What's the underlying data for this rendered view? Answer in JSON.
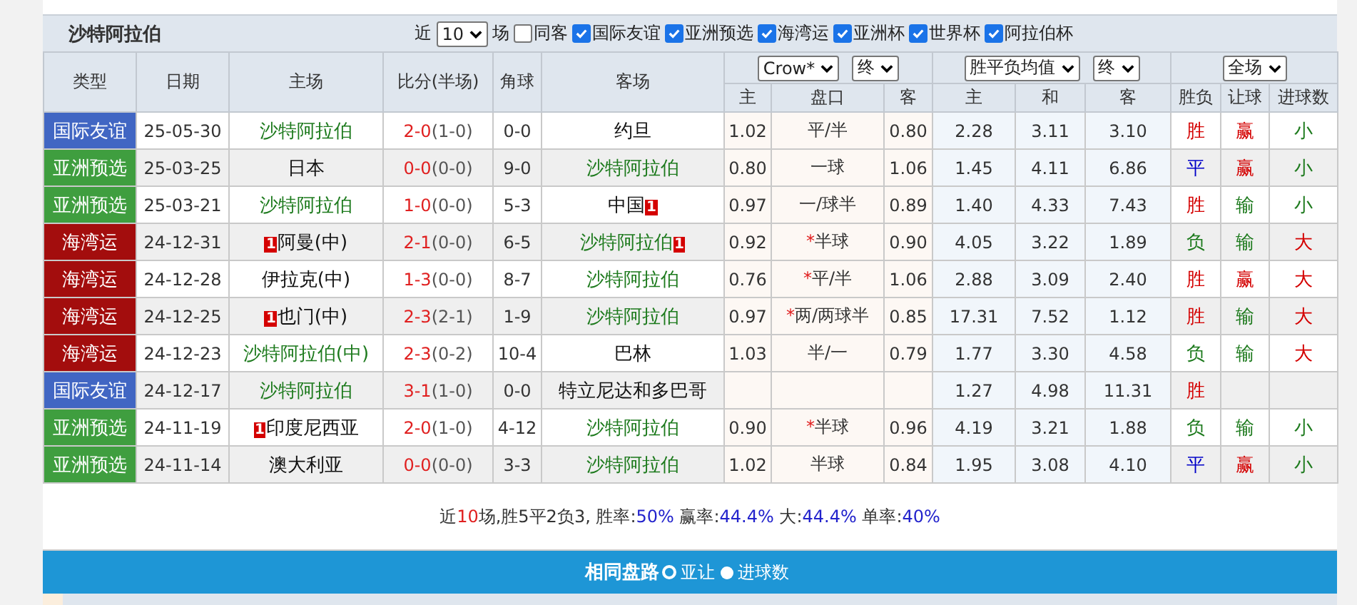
{
  "filter_bar": {
    "team": "沙特阿拉伯",
    "recent_prefix": "近",
    "recent_count": "10",
    "recent_suffix": "场",
    "checkboxes": [
      {
        "label": "同客",
        "checked": false
      },
      {
        "label": "国际友谊",
        "checked": true
      },
      {
        "label": "亚洲预选",
        "checked": true
      },
      {
        "label": "海湾运",
        "checked": true
      },
      {
        "label": "亚洲杯",
        "checked": true
      },
      {
        "label": "世界杯",
        "checked": true
      },
      {
        "label": "阿拉伯杯",
        "checked": true
      }
    ]
  },
  "columns": [
    "类型",
    "日期",
    "主场",
    "比分(半场)",
    "角球",
    "客场"
  ],
  "selects": {
    "handicap_company": "Crow*",
    "handicap_time": "终",
    "euro_company": "胜平负均值",
    "euro_time": "终",
    "period": "全场"
  },
  "subcolumns": [
    "主",
    "盘口",
    "客",
    "主",
    "和",
    "客",
    "胜负",
    "让球",
    "进球数"
  ],
  "rows": [
    {
      "type": {
        "label": "国际友谊",
        "color": "#4166c3"
      },
      "date": "25-05-30",
      "home": {
        "name": "沙特阿拉伯",
        "highlight": true
      },
      "score": {
        "full": "2-0",
        "half": "(1-0)"
      },
      "corners": "0-0",
      "away": {
        "name": "约旦",
        "highlight": false
      },
      "handicap": {
        "home": "1.02",
        "line": "平/半",
        "away": "0.80"
      },
      "euro": {
        "home": "2.28",
        "draw": "3.11",
        "away": "3.10"
      },
      "result": {
        "label": "胜",
        "kind": "win"
      },
      "cover": {
        "label": "赢",
        "kind": "win"
      },
      "goals": {
        "label": "小",
        "kind": "under"
      }
    },
    {
      "type": {
        "label": "亚洲预选",
        "color": "#3f9e3f"
      },
      "date": "25-03-25",
      "home": {
        "name": "日本",
        "highlight": false
      },
      "score": {
        "full": "0-0",
        "half": "(0-0)"
      },
      "corners": "9-0",
      "away": {
        "name": "沙特阿拉伯",
        "highlight": true
      },
      "handicap": {
        "home": "0.80",
        "line": "一球",
        "away": "1.06"
      },
      "euro": {
        "home": "1.45",
        "draw": "4.11",
        "away": "6.86"
      },
      "result": {
        "label": "平",
        "kind": "draw"
      },
      "cover": {
        "label": "赢",
        "kind": "win"
      },
      "goals": {
        "label": "小",
        "kind": "under"
      }
    },
    {
      "type": {
        "label": "亚洲预选",
        "color": "#3f9e3f"
      },
      "date": "25-03-21",
      "home": {
        "name": "沙特阿拉伯",
        "highlight": true
      },
      "score": {
        "full": "1-0",
        "half": "(0-0)"
      },
      "corners": "5-3",
      "away": {
        "name": "中国",
        "highlight": false,
        "rank_after": "1"
      },
      "handicap": {
        "home": "0.97",
        "line": "一/球半",
        "away": "0.89"
      },
      "euro": {
        "home": "1.40",
        "draw": "4.33",
        "away": "7.43"
      },
      "result": {
        "label": "胜",
        "kind": "win"
      },
      "cover": {
        "label": "输",
        "kind": "loss"
      },
      "goals": {
        "label": "小",
        "kind": "under"
      }
    },
    {
      "type": {
        "label": "海湾运",
        "color": "#a30d0d"
      },
      "date": "24-12-31",
      "home": {
        "name": "阿曼(中)",
        "highlight": false,
        "rank_before": "1"
      },
      "score": {
        "full": "2-1",
        "half": "(0-0)"
      },
      "corners": "6-5",
      "away": {
        "name": "沙特阿拉伯",
        "highlight": true,
        "rank_after": "1"
      },
      "handicap": {
        "home": "0.92",
        "line": "半球",
        "star": "*",
        "away": "0.90"
      },
      "euro": {
        "home": "4.05",
        "draw": "3.22",
        "away": "1.89"
      },
      "result": {
        "label": "负",
        "kind": "loss"
      },
      "cover": {
        "label": "输",
        "kind": "loss"
      },
      "goals": {
        "label": "大",
        "kind": "over"
      }
    },
    {
      "type": {
        "label": "海湾运",
        "color": "#a30d0d"
      },
      "date": "24-12-28",
      "home": {
        "name": "伊拉克(中)",
        "highlight": false
      },
      "score": {
        "full": "1-3",
        "half": "(0-0)"
      },
      "corners": "8-7",
      "away": {
        "name": "沙特阿拉伯",
        "highlight": true
      },
      "handicap": {
        "home": "0.76",
        "line": "平/半",
        "star": "*",
        "away": "1.06"
      },
      "euro": {
        "home": "2.88",
        "draw": "3.09",
        "away": "2.40"
      },
      "result": {
        "label": "胜",
        "kind": "win"
      },
      "cover": {
        "label": "赢",
        "kind": "win"
      },
      "goals": {
        "label": "大",
        "kind": "over"
      }
    },
    {
      "type": {
        "label": "海湾运",
        "color": "#a30d0d"
      },
      "date": "24-12-25",
      "home": {
        "name": "也门(中)",
        "highlight": false,
        "rank_before": "1"
      },
      "score": {
        "full": "2-3",
        "half": "(2-1)"
      },
      "corners": "1-9",
      "away": {
        "name": "沙特阿拉伯",
        "highlight": true
      },
      "handicap": {
        "home": "0.97",
        "line": "两/两球半",
        "star": "*",
        "away": "0.85"
      },
      "euro": {
        "home": "17.31",
        "draw": "7.52",
        "away": "1.12"
      },
      "result": {
        "label": "胜",
        "kind": "win"
      },
      "cover": {
        "label": "输",
        "kind": "loss"
      },
      "goals": {
        "label": "大",
        "kind": "over"
      }
    },
    {
      "type": {
        "label": "海湾运",
        "color": "#a30d0d"
      },
      "date": "24-12-23",
      "home": {
        "name": "沙特阿拉伯(中)",
        "highlight": true
      },
      "score": {
        "full": "2-3",
        "half": "(0-2)"
      },
      "corners": "10-4",
      "away": {
        "name": "巴林",
        "highlight": false
      },
      "handicap": {
        "home": "1.03",
        "line": "半/一",
        "away": "0.79"
      },
      "euro": {
        "home": "1.77",
        "draw": "3.30",
        "away": "4.58"
      },
      "result": {
        "label": "负",
        "kind": "loss"
      },
      "cover": {
        "label": "输",
        "kind": "loss"
      },
      "goals": {
        "label": "大",
        "kind": "over"
      }
    },
    {
      "type": {
        "label": "国际友谊",
        "color": "#4166c3"
      },
      "date": "24-12-17",
      "home": {
        "name": "沙特阿拉伯",
        "highlight": true
      },
      "score": {
        "full": "3-1",
        "half": "(1-0)"
      },
      "corners": "0-0",
      "away": {
        "name": "特立尼达和多巴哥",
        "highlight": false
      },
      "euro": {
        "home": "1.27",
        "draw": "4.98",
        "away": "11.31"
      },
      "result": {
        "label": "胜",
        "kind": "win"
      }
    },
    {
      "type": {
        "label": "亚洲预选",
        "color": "#3f9e3f"
      },
      "date": "24-11-19",
      "home": {
        "name": "印度尼西亚",
        "highlight": false,
        "rank_before": "1"
      },
      "score": {
        "full": "2-0",
        "half": "(1-0)"
      },
      "corners": "4-12",
      "away": {
        "name": "沙特阿拉伯",
        "highlight": true
      },
      "handicap": {
        "home": "0.90",
        "line": "半球",
        "star": "*",
        "away": "0.96"
      },
      "euro": {
        "home": "4.19",
        "draw": "3.21",
        "away": "1.88"
      },
      "result": {
        "label": "负",
        "kind": "loss"
      },
      "cover": {
        "label": "输",
        "kind": "loss"
      },
      "goals": {
        "label": "小",
        "kind": "under"
      }
    },
    {
      "type": {
        "label": "亚洲预选",
        "color": "#3f9e3f"
      },
      "date": "24-11-14",
      "home": {
        "name": "澳大利亚",
        "highlight": false
      },
      "score": {
        "full": "0-0",
        "half": "(0-0)"
      },
      "corners": "3-3",
      "away": {
        "name": "沙特阿拉伯",
        "highlight": true
      },
      "handicap": {
        "home": "1.02",
        "line": "半球",
        "away": "0.84"
      },
      "euro": {
        "home": "1.95",
        "draw": "3.08",
        "away": "4.10"
      },
      "result": {
        "label": "平",
        "kind": "draw"
      },
      "cover": {
        "label": "赢",
        "kind": "win"
      },
      "goals": {
        "label": "小",
        "kind": "under"
      }
    }
  ],
  "summary": [
    {
      "kind": "plain",
      "text": "近"
    },
    {
      "kind": "count",
      "text": "10"
    },
    {
      "kind": "plain",
      "text": "场,胜5平2负3, 胜率:"
    },
    {
      "kind": "rate",
      "text": "50%"
    },
    {
      "kind": "plain",
      "text": " 赢率:"
    },
    {
      "kind": "rate",
      "text": "44.4%"
    },
    {
      "kind": "plain",
      "text": " 大:"
    },
    {
      "kind": "rate",
      "text": "44.4%"
    },
    {
      "kind": "plain",
      "text": " 单率:"
    },
    {
      "kind": "rate",
      "text": "40%"
    }
  ],
  "same_line_bar": {
    "title": "相同盘路",
    "options": [
      {
        "label": "亚让",
        "selected": true
      },
      {
        "label": "进球数",
        "selected": false
      }
    ]
  }
}
